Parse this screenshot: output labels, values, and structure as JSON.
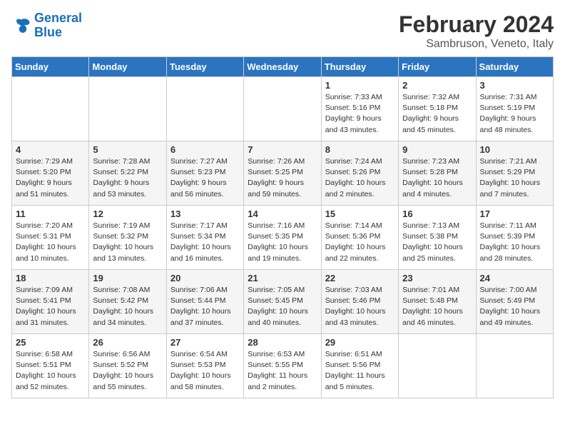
{
  "header": {
    "logo_line1": "General",
    "logo_line2": "Blue",
    "title": "February 2024",
    "subtitle": "Sambruson, Veneto, Italy"
  },
  "weekdays": [
    "Sunday",
    "Monday",
    "Tuesday",
    "Wednesday",
    "Thursday",
    "Friday",
    "Saturday"
  ],
  "weeks": [
    [
      {
        "day": "",
        "sunrise": "",
        "sunset": "",
        "daylight": "",
        "empty": true
      },
      {
        "day": "",
        "sunrise": "",
        "sunset": "",
        "daylight": "",
        "empty": true
      },
      {
        "day": "",
        "sunrise": "",
        "sunset": "",
        "daylight": "",
        "empty": true
      },
      {
        "day": "",
        "sunrise": "",
        "sunset": "",
        "daylight": "",
        "empty": true
      },
      {
        "day": "1",
        "sunrise": "Sunrise: 7:33 AM",
        "sunset": "Sunset: 5:16 PM",
        "daylight": "Daylight: 9 hours and 43 minutes.",
        "empty": false
      },
      {
        "day": "2",
        "sunrise": "Sunrise: 7:32 AM",
        "sunset": "Sunset: 5:18 PM",
        "daylight": "Daylight: 9 hours and 45 minutes.",
        "empty": false
      },
      {
        "day": "3",
        "sunrise": "Sunrise: 7:31 AM",
        "sunset": "Sunset: 5:19 PM",
        "daylight": "Daylight: 9 hours and 48 minutes.",
        "empty": false
      }
    ],
    [
      {
        "day": "4",
        "sunrise": "Sunrise: 7:29 AM",
        "sunset": "Sunset: 5:20 PM",
        "daylight": "Daylight: 9 hours and 51 minutes.",
        "empty": false
      },
      {
        "day": "5",
        "sunrise": "Sunrise: 7:28 AM",
        "sunset": "Sunset: 5:22 PM",
        "daylight": "Daylight: 9 hours and 53 minutes.",
        "empty": false
      },
      {
        "day": "6",
        "sunrise": "Sunrise: 7:27 AM",
        "sunset": "Sunset: 5:23 PM",
        "daylight": "Daylight: 9 hours and 56 minutes.",
        "empty": false
      },
      {
        "day": "7",
        "sunrise": "Sunrise: 7:26 AM",
        "sunset": "Sunset: 5:25 PM",
        "daylight": "Daylight: 9 hours and 59 minutes.",
        "empty": false
      },
      {
        "day": "8",
        "sunrise": "Sunrise: 7:24 AM",
        "sunset": "Sunset: 5:26 PM",
        "daylight": "Daylight: 10 hours and 2 minutes.",
        "empty": false
      },
      {
        "day": "9",
        "sunrise": "Sunrise: 7:23 AM",
        "sunset": "Sunset: 5:28 PM",
        "daylight": "Daylight: 10 hours and 4 minutes.",
        "empty": false
      },
      {
        "day": "10",
        "sunrise": "Sunrise: 7:21 AM",
        "sunset": "Sunset: 5:29 PM",
        "daylight": "Daylight: 10 hours and 7 minutes.",
        "empty": false
      }
    ],
    [
      {
        "day": "11",
        "sunrise": "Sunrise: 7:20 AM",
        "sunset": "Sunset: 5:31 PM",
        "daylight": "Daylight: 10 hours and 10 minutes.",
        "empty": false
      },
      {
        "day": "12",
        "sunrise": "Sunrise: 7:19 AM",
        "sunset": "Sunset: 5:32 PM",
        "daylight": "Daylight: 10 hours and 13 minutes.",
        "empty": false
      },
      {
        "day": "13",
        "sunrise": "Sunrise: 7:17 AM",
        "sunset": "Sunset: 5:34 PM",
        "daylight": "Daylight: 10 hours and 16 minutes.",
        "empty": false
      },
      {
        "day": "14",
        "sunrise": "Sunrise: 7:16 AM",
        "sunset": "Sunset: 5:35 PM",
        "daylight": "Daylight: 10 hours and 19 minutes.",
        "empty": false
      },
      {
        "day": "15",
        "sunrise": "Sunrise: 7:14 AM",
        "sunset": "Sunset: 5:36 PM",
        "daylight": "Daylight: 10 hours and 22 minutes.",
        "empty": false
      },
      {
        "day": "16",
        "sunrise": "Sunrise: 7:13 AM",
        "sunset": "Sunset: 5:38 PM",
        "daylight": "Daylight: 10 hours and 25 minutes.",
        "empty": false
      },
      {
        "day": "17",
        "sunrise": "Sunrise: 7:11 AM",
        "sunset": "Sunset: 5:39 PM",
        "daylight": "Daylight: 10 hours and 28 minutes.",
        "empty": false
      }
    ],
    [
      {
        "day": "18",
        "sunrise": "Sunrise: 7:09 AM",
        "sunset": "Sunset: 5:41 PM",
        "daylight": "Daylight: 10 hours and 31 minutes.",
        "empty": false
      },
      {
        "day": "19",
        "sunrise": "Sunrise: 7:08 AM",
        "sunset": "Sunset: 5:42 PM",
        "daylight": "Daylight: 10 hours and 34 minutes.",
        "empty": false
      },
      {
        "day": "20",
        "sunrise": "Sunrise: 7:06 AM",
        "sunset": "Sunset: 5:44 PM",
        "daylight": "Daylight: 10 hours and 37 minutes.",
        "empty": false
      },
      {
        "day": "21",
        "sunrise": "Sunrise: 7:05 AM",
        "sunset": "Sunset: 5:45 PM",
        "daylight": "Daylight: 10 hours and 40 minutes.",
        "empty": false
      },
      {
        "day": "22",
        "sunrise": "Sunrise: 7:03 AM",
        "sunset": "Sunset: 5:46 PM",
        "daylight": "Daylight: 10 hours and 43 minutes.",
        "empty": false
      },
      {
        "day": "23",
        "sunrise": "Sunrise: 7:01 AM",
        "sunset": "Sunset: 5:48 PM",
        "daylight": "Daylight: 10 hours and 46 minutes.",
        "empty": false
      },
      {
        "day": "24",
        "sunrise": "Sunrise: 7:00 AM",
        "sunset": "Sunset: 5:49 PM",
        "daylight": "Daylight: 10 hours and 49 minutes.",
        "empty": false
      }
    ],
    [
      {
        "day": "25",
        "sunrise": "Sunrise: 6:58 AM",
        "sunset": "Sunset: 5:51 PM",
        "daylight": "Daylight: 10 hours and 52 minutes.",
        "empty": false
      },
      {
        "day": "26",
        "sunrise": "Sunrise: 6:56 AM",
        "sunset": "Sunset: 5:52 PM",
        "daylight": "Daylight: 10 hours and 55 minutes.",
        "empty": false
      },
      {
        "day": "27",
        "sunrise": "Sunrise: 6:54 AM",
        "sunset": "Sunset: 5:53 PM",
        "daylight": "Daylight: 10 hours and 58 minutes.",
        "empty": false
      },
      {
        "day": "28",
        "sunrise": "Sunrise: 6:53 AM",
        "sunset": "Sunset: 5:55 PM",
        "daylight": "Daylight: 11 hours and 2 minutes.",
        "empty": false
      },
      {
        "day": "29",
        "sunrise": "Sunrise: 6:51 AM",
        "sunset": "Sunset: 5:56 PM",
        "daylight": "Daylight: 11 hours and 5 minutes.",
        "empty": false
      },
      {
        "day": "",
        "sunrise": "",
        "sunset": "",
        "daylight": "",
        "empty": true
      },
      {
        "day": "",
        "sunrise": "",
        "sunset": "",
        "daylight": "",
        "empty": true
      }
    ]
  ]
}
